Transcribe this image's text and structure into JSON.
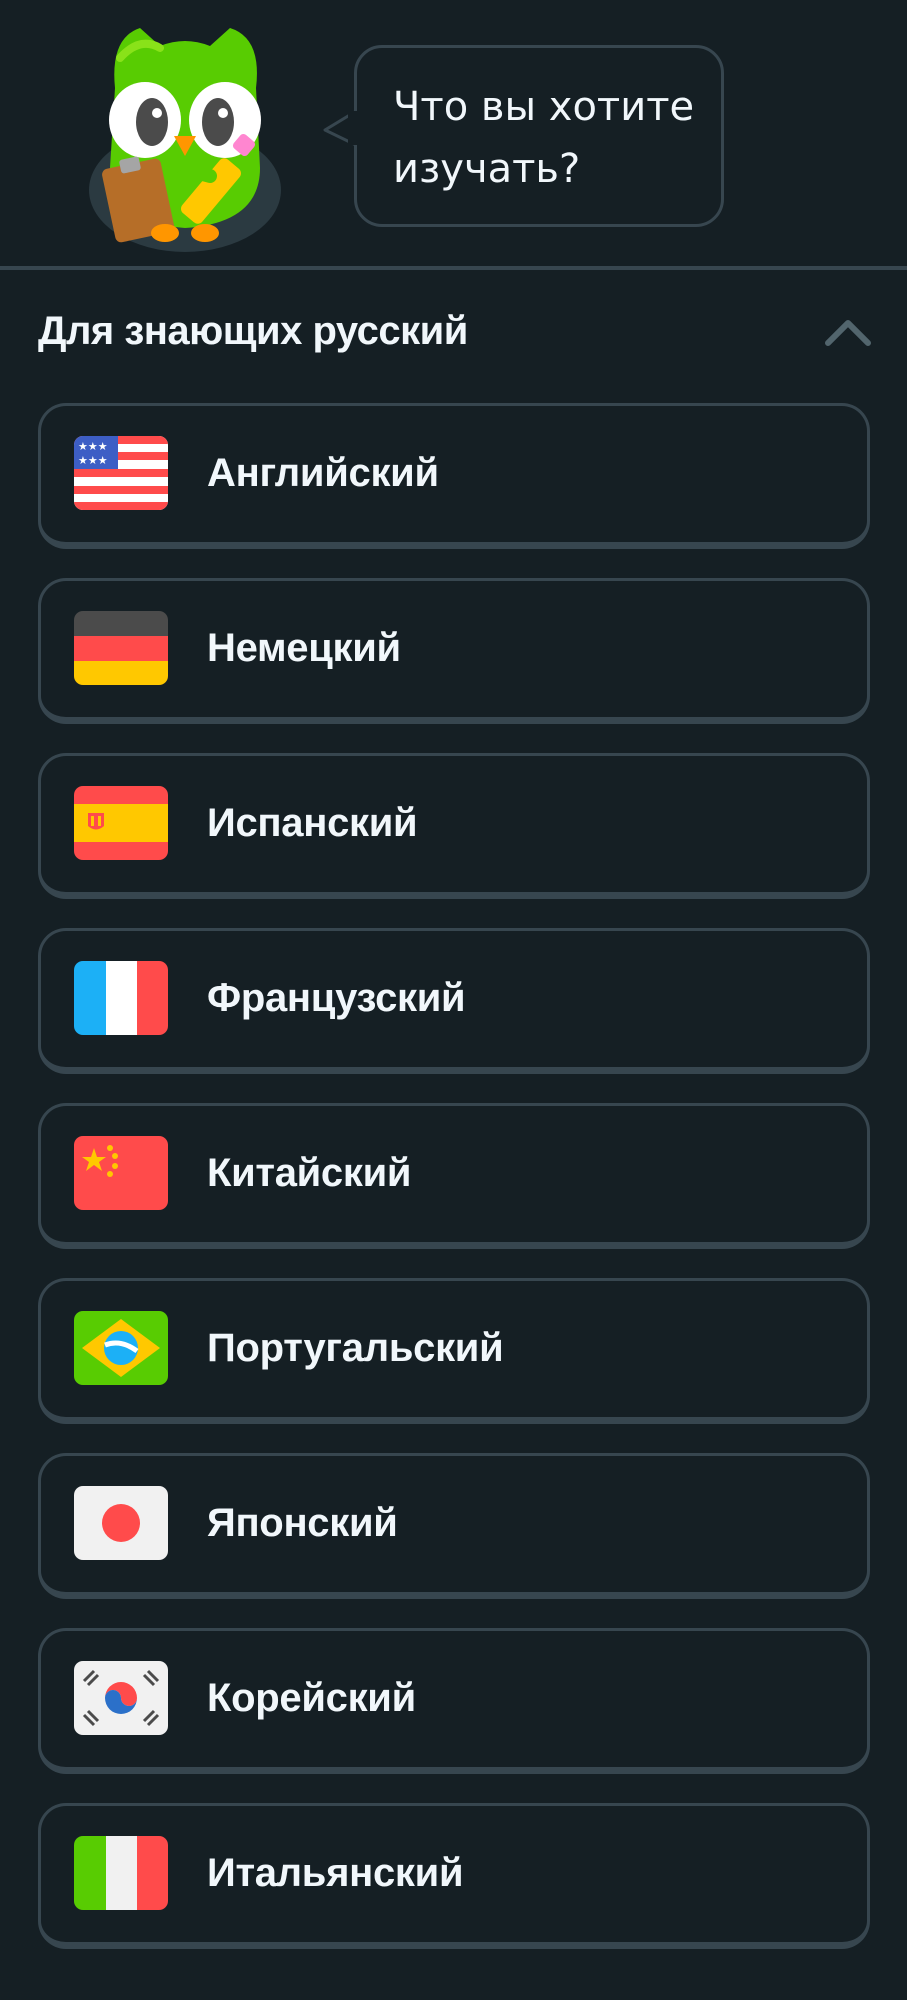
{
  "prompt": {
    "line1": "Что вы хотите",
    "line2": "изучать?"
  },
  "section": {
    "title": "Для знающих русский",
    "collapse_icon": "chevron-up-icon"
  },
  "languages": [
    {
      "label": "Английский",
      "flag": "flag-usa-icon"
    },
    {
      "label": "Немецкий",
      "flag": "flag-germany-icon"
    },
    {
      "label": "Испанский",
      "flag": "flag-spain-icon"
    },
    {
      "label": "Французский",
      "flag": "flag-france-icon"
    },
    {
      "label": "Китайский",
      "flag": "flag-china-icon"
    },
    {
      "label": "Португальский",
      "flag": "flag-brazil-icon"
    },
    {
      "label": "Японский",
      "flag": "flag-japan-icon"
    },
    {
      "label": "Корейский",
      "flag": "flag-korea-icon"
    },
    {
      "label": "Итальянский",
      "flag": "flag-italy-icon"
    }
  ],
  "colors": {
    "background": "#151f24",
    "border": "#37464f",
    "text": "#f1f7fb",
    "mascot_green": "#58cc02"
  }
}
